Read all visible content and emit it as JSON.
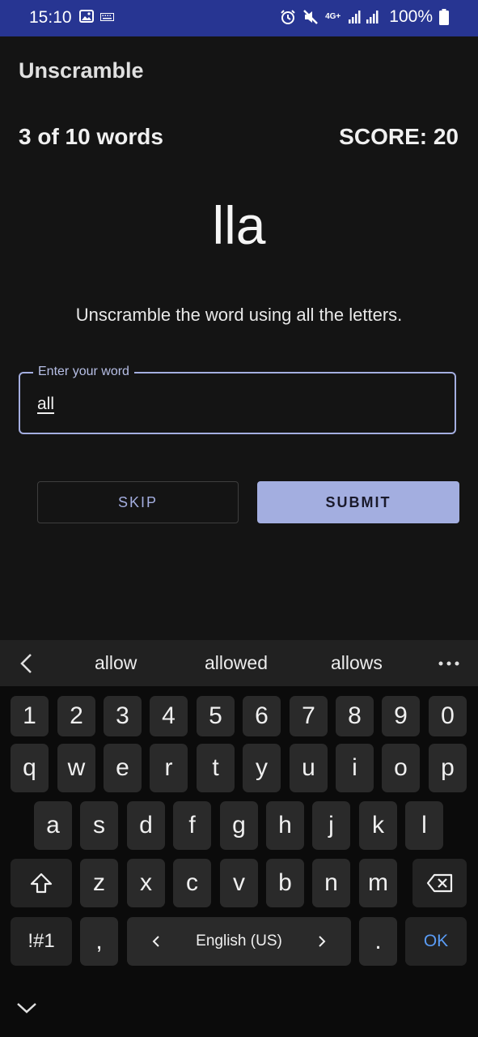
{
  "status_bar": {
    "time": "15:10",
    "network": "4G+",
    "battery": "100%",
    "icons": [
      "gallery-icon",
      "keyboard-icon",
      "alarm-icon",
      "mute-icon",
      "signal-icon",
      "battery-icon"
    ]
  },
  "app": {
    "title": "Unscramble"
  },
  "game": {
    "word_count": "3 of 10 words",
    "score": "SCORE: 20",
    "scrambled_word": "lla",
    "instructions": "Unscramble the word using all the letters."
  },
  "input": {
    "label": "Enter your word",
    "value": "all"
  },
  "buttons": {
    "skip": "SKIP",
    "submit": "SUBMIT"
  },
  "keyboard": {
    "suggestions": [
      "allow",
      "allowed",
      "allows"
    ],
    "row_numbers": [
      "1",
      "2",
      "3",
      "4",
      "5",
      "6",
      "7",
      "8",
      "9",
      "0"
    ],
    "row_qwerty": [
      "q",
      "w",
      "e",
      "r",
      "t",
      "y",
      "u",
      "i",
      "o",
      "p"
    ],
    "row_asdf": [
      "a",
      "s",
      "d",
      "f",
      "g",
      "h",
      "j",
      "k",
      "l"
    ],
    "row_zxcv": [
      "z",
      "x",
      "c",
      "v",
      "b",
      "n",
      "m"
    ],
    "symbols_key": "!#1",
    "comma_key": ",",
    "language": "English (US)",
    "period_key": ".",
    "ok_key": "OK"
  },
  "colors": {
    "status_bar": "#273592",
    "accent": "#a3aee0",
    "background": "#141414",
    "ok_blue": "#5a9cf5"
  }
}
